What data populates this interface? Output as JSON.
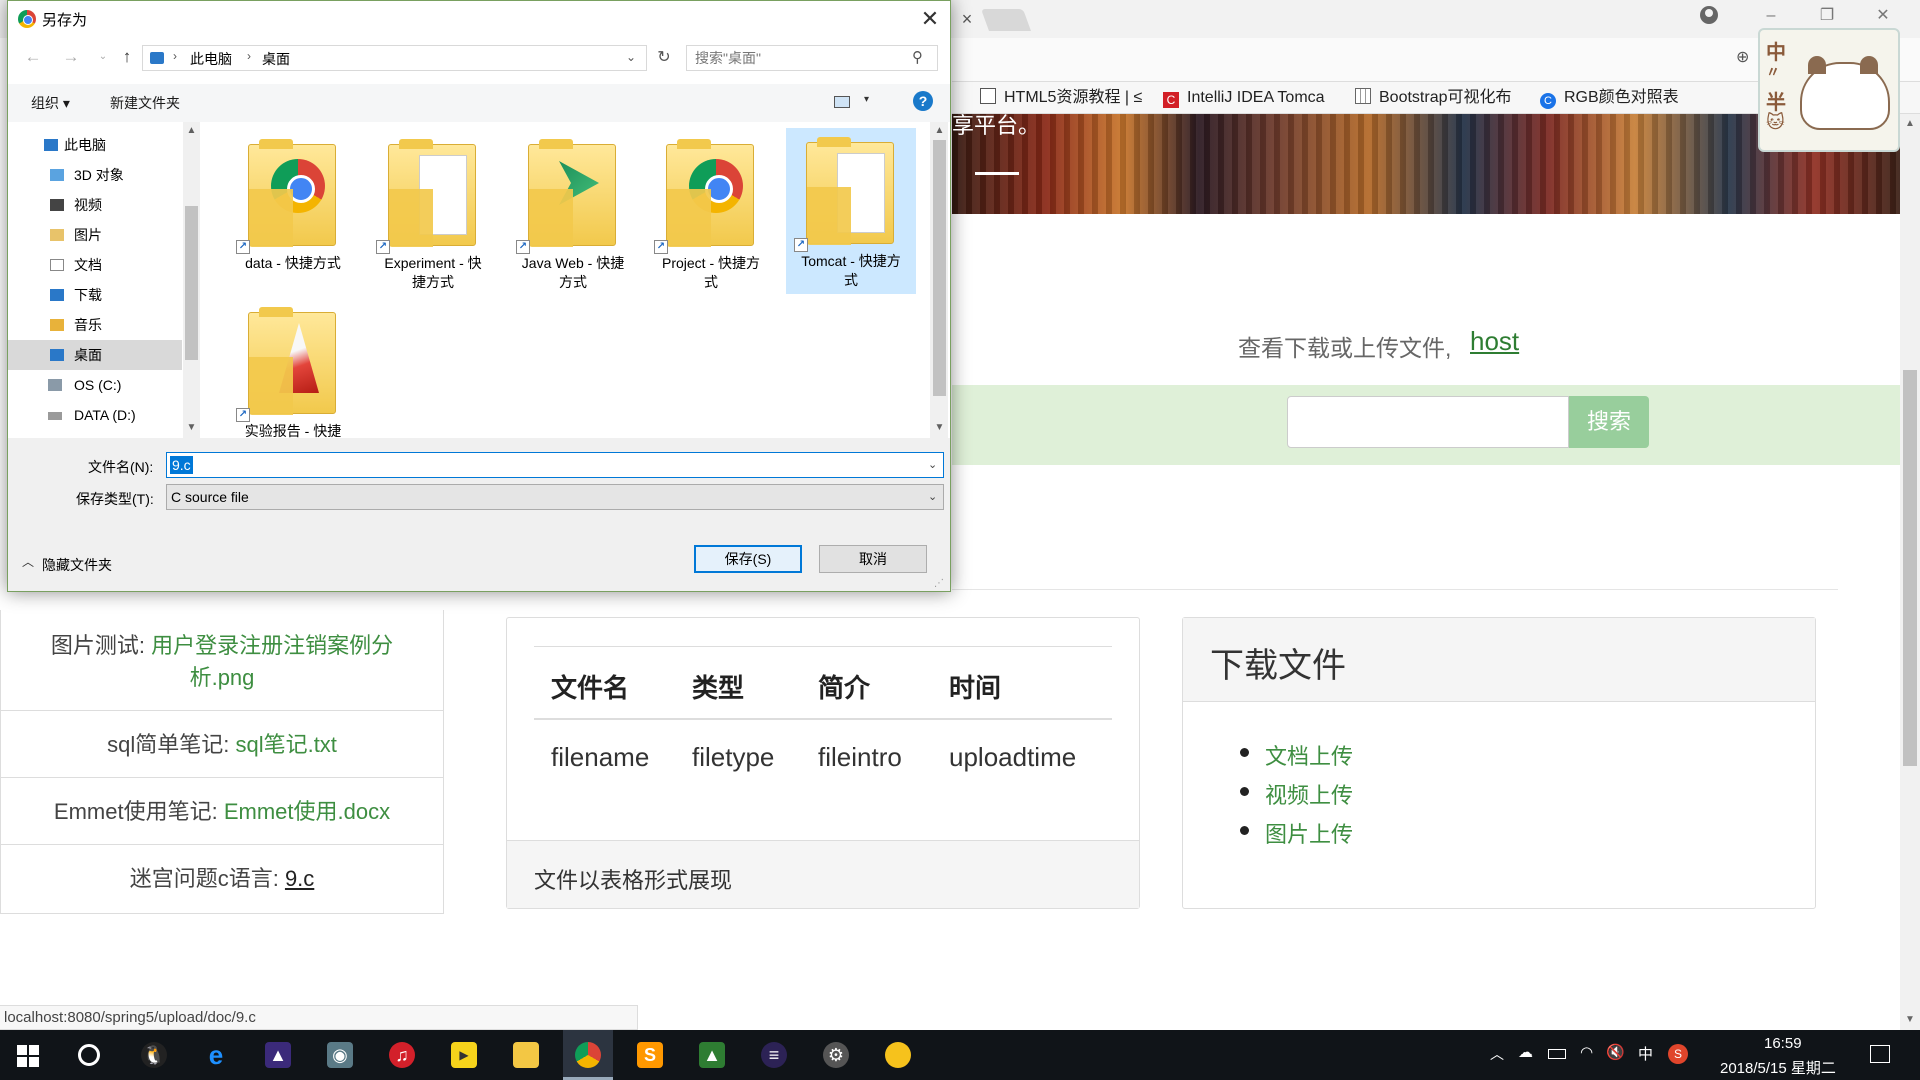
{
  "browser": {
    "bookmarks": [
      {
        "label": "HTML5资源教程 | ≤",
        "icon": "page-icon"
      },
      {
        "label": "IntelliJ IDEA Tomca",
        "icon": "red-c-icon"
      },
      {
        "label": "Bootstrap可视化布",
        "icon": "grid-icon"
      },
      {
        "label": "RGB颜色对照表",
        "icon": "blue-c-icon"
      }
    ],
    "hero_text": "享平台。",
    "mascot_chars": [
      "中",
      "〃",
      "半",
      "🐱"
    ]
  },
  "page": {
    "intro_text": "查看下载或上传文件,",
    "host_link": "host",
    "search_button": "搜索",
    "side_list": [
      {
        "label": "图片测试:",
        "link": "用户登录注册注销案例分析.png",
        "link_line1": "用户登录注册注销案例分",
        "link_line2": "析.png"
      },
      {
        "label": "sql简单笔记:",
        "link": "sql笔记.txt"
      },
      {
        "label": "Emmet使用笔记:",
        "link": "Emmet使用.docx"
      },
      {
        "label": "迷宫问题c语言:",
        "link": "9.c"
      }
    ],
    "file_table": {
      "headers": [
        "文件名",
        "类型",
        "简介",
        "时间"
      ],
      "rows": [
        [
          "filename",
          "filetype",
          "fileintro",
          "uploadtime"
        ]
      ],
      "footer": "文件以表格形式展现"
    },
    "download_panel": {
      "title": "下载文件",
      "items": [
        "文档上传",
        "视频上传",
        "图片上传"
      ]
    },
    "status_url": "localhost:8080/spring5/upload/doc/9.c"
  },
  "dialog": {
    "title": "另存为",
    "breadcrumb": [
      "此电脑",
      "桌面"
    ],
    "search_placeholder": "搜索\"桌面\"",
    "toolbar": {
      "organize": "组织 ▾",
      "new_folder": "新建文件夹",
      "help": "?"
    },
    "nav_items": [
      {
        "label": "此电脑",
        "icon": "computer-icon"
      },
      {
        "label": "3D 对象",
        "icon": "3d-objects-icon"
      },
      {
        "label": "视频",
        "icon": "videos-icon"
      },
      {
        "label": "图片",
        "icon": "pictures-icon"
      },
      {
        "label": "文档",
        "icon": "documents-icon"
      },
      {
        "label": "下载",
        "icon": "downloads-icon"
      },
      {
        "label": "音乐",
        "icon": "music-icon"
      },
      {
        "label": "桌面",
        "icon": "desktop-icon",
        "selected": true
      },
      {
        "label": "OS (C:)",
        "icon": "drive-c-icon"
      },
      {
        "label": "DATA (D:)",
        "icon": "drive-d-icon"
      }
    ],
    "files": [
      {
        "line1": "data - 快捷方式",
        "line2": "",
        "badge": "chrome"
      },
      {
        "line1": "Experiment - 快",
        "line2": "捷方式",
        "badge": "paper"
      },
      {
        "line1": "Java Web - 快捷",
        "line2": "方式",
        "badge": "arrow"
      },
      {
        "line1": "Project - 快捷方",
        "line2": "式",
        "badge": "chrome"
      },
      {
        "line1": "Tomcat - 快捷方",
        "line2": "式",
        "badge": "paper",
        "selected": true
      },
      {
        "line1": "实验报告 - 快捷",
        "line2": "",
        "badge": "pdf"
      }
    ],
    "filename_label": "文件名(N):",
    "filename_value": "9.c",
    "filetype_label": "保存类型(T):",
    "filetype_value": "C source file",
    "hide_folders": "隐藏文件夹",
    "save_button": "保存(S)",
    "cancel_button": "取消"
  },
  "taskbar": {
    "ime": "中",
    "time": "16:59",
    "date": "2018/5/15 星期二"
  },
  "colors": {
    "accent_green": "#3e8e41",
    "search_band": "#dff0d8",
    "selection_blue": "#0078d7"
  }
}
